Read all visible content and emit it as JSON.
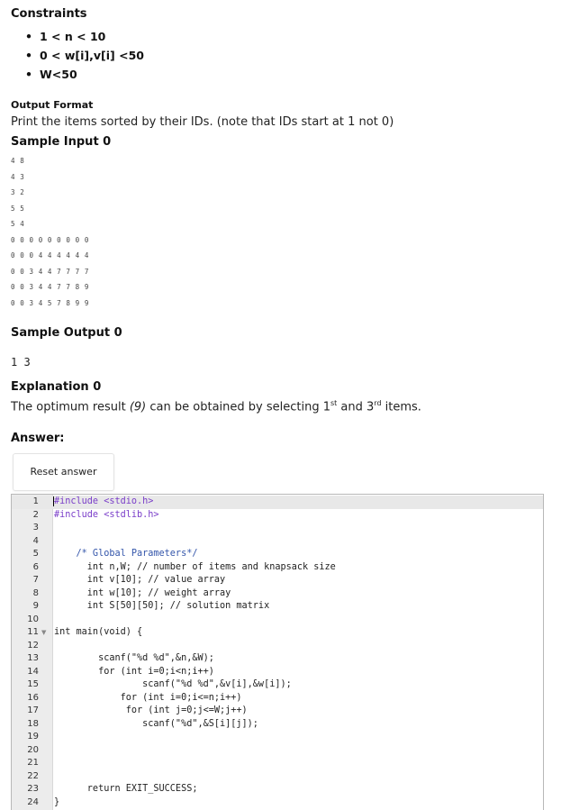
{
  "top_cut_text": "",
  "constraints": {
    "heading": "Constraints",
    "items": [
      "1 < n < 10",
      "0 < w[i],v[i] <50",
      "W<50"
    ]
  },
  "output_format": {
    "heading": "Output Format",
    "text": "Print the items sorted by their IDs. (note that IDs start at 1 not 0)"
  },
  "sample_input": {
    "heading": "Sample Input 0",
    "lines": [
      "4 8",
      "4 3",
      "3 2",
      "5 5",
      "5 4",
      "0 0 0 0 0 0 0 0 0",
      "0 0 0 4 4 4 4 4 4",
      "0 0 3 4 4 7 7 7 7",
      "0 0 3 4 4 7 7 8 9",
      "0 0 3 4 5 7 8 9 9"
    ]
  },
  "sample_output": {
    "heading": "Sample Output 0",
    "value": "1 3"
  },
  "explanation": {
    "heading": "Explanation 0",
    "text_before": "The optimum result ",
    "emphasis": "(9)",
    "text_mid": " can be obtained by selecting 1",
    "sup1": "st",
    "text_and": " and 3",
    "sup2": "rd",
    "text_after": " items."
  },
  "answer": {
    "heading": "Answer:",
    "reset_label": "Reset answer"
  },
  "editor": {
    "lines": [
      {
        "n": "1",
        "code": "#include <stdio.h>"
      },
      {
        "n": "2",
        "code": "#include <stdlib.h>"
      },
      {
        "n": "3",
        "code": ""
      },
      {
        "n": "4",
        "code": ""
      },
      {
        "n": "5",
        "code": "    /* Global Parameters*/"
      },
      {
        "n": "6",
        "code": "      int n,W; // number of items and knapsack size"
      },
      {
        "n": "7",
        "code": "      int v[10]; // value array"
      },
      {
        "n": "8",
        "code": "      int w[10]; // weight array"
      },
      {
        "n": "9",
        "code": "      int S[50][50]; // solution matrix"
      },
      {
        "n": "10",
        "code": ""
      },
      {
        "n": "11",
        "code": "int main(void) {"
      },
      {
        "n": "12",
        "code": ""
      },
      {
        "n": "13",
        "code": "        scanf(\"%d %d\",&n,&W);"
      },
      {
        "n": "14",
        "code": "        for (int i=0;i<n;i++)"
      },
      {
        "n": "15",
        "code": "                scanf(\"%d %d\",&v[i],&w[i]);"
      },
      {
        "n": "16",
        "code": "            for (int i=0;i<=n;i++)"
      },
      {
        "n": "17",
        "code": "             for (int j=0;j<=W;j++)"
      },
      {
        "n": "18",
        "code": "                scanf(\"%d\",&S[i][j]);"
      },
      {
        "n": "19",
        "code": ""
      },
      {
        "n": "20",
        "code": ""
      },
      {
        "n": "21",
        "code": ""
      },
      {
        "n": "22",
        "code": ""
      },
      {
        "n": "23",
        "code": "      return EXIT_SUCCESS;"
      },
      {
        "n": "24",
        "code": "}"
      }
    ]
  }
}
